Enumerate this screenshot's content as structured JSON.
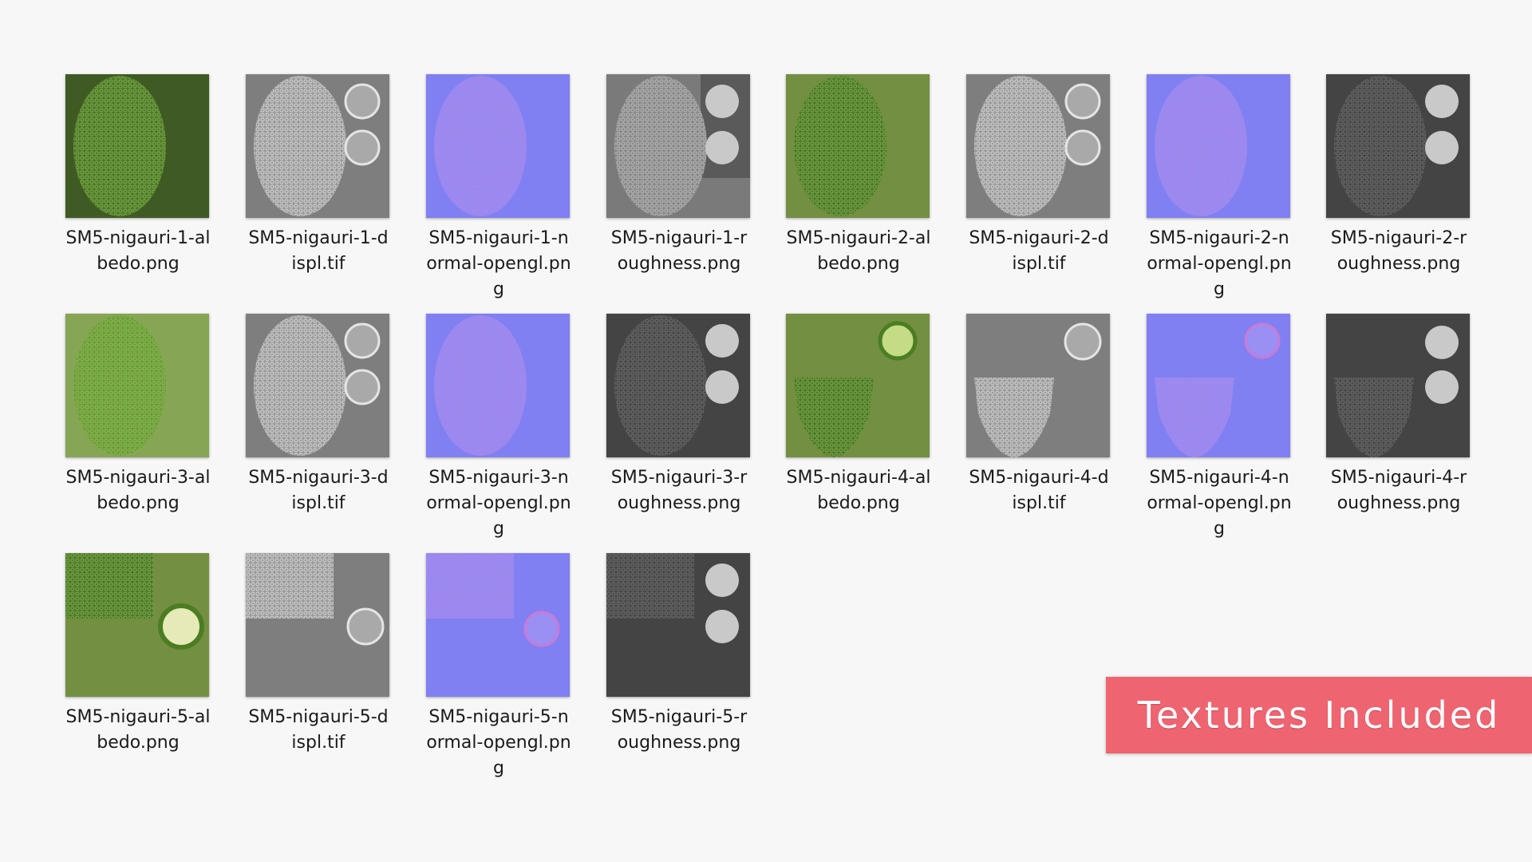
{
  "files": [
    {
      "line1": "SM5-nigauri-1-al",
      "line2": "bedo.png",
      "line3": "",
      "kind": "albedo",
      "variant": 1
    },
    {
      "line1": "SM5-nigauri-1-d",
      "line2": "ispl.tif",
      "line3": "",
      "kind": "displ",
      "variant": 1
    },
    {
      "line1": "SM5-nigauri-1-n",
      "line2": "ormal-opengl.pn",
      "line3": "g",
      "kind": "normal",
      "variant": 1
    },
    {
      "line1": "SM5-nigauri-1-r",
      "line2": "oughness.png",
      "line3": "",
      "kind": "roughness",
      "variant": 1
    },
    {
      "line1": "SM5-nigauri-2-al",
      "line2": "bedo.png",
      "line3": "",
      "kind": "albedo",
      "variant": 2
    },
    {
      "line1": "SM5-nigauri-2-d",
      "line2": "ispl.tif",
      "line3": "",
      "kind": "displ",
      "variant": 2
    },
    {
      "line1": "SM5-nigauri-2-n",
      "line2": "ormal-opengl.pn",
      "line3": "g",
      "kind": "normal",
      "variant": 2
    },
    {
      "line1": "SM5-nigauri-2-r",
      "line2": "oughness.png",
      "line3": "",
      "kind": "roughness",
      "variant": 2
    },
    {
      "line1": "SM5-nigauri-3-al",
      "line2": "bedo.png",
      "line3": "",
      "kind": "albedo",
      "variant": 3
    },
    {
      "line1": "SM5-nigauri-3-d",
      "line2": "ispl.tif",
      "line3": "",
      "kind": "displ",
      "variant": 3
    },
    {
      "line1": "SM5-nigauri-3-n",
      "line2": "ormal-opengl.pn",
      "line3": "g",
      "kind": "normal",
      "variant": 3
    },
    {
      "line1": "SM5-nigauri-3-r",
      "line2": "oughness.png",
      "line3": "",
      "kind": "roughness",
      "variant": 3
    },
    {
      "line1": "SM5-nigauri-4-al",
      "line2": "bedo.png",
      "line3": "",
      "kind": "albedo",
      "variant": 4
    },
    {
      "line1": "SM5-nigauri-4-d",
      "line2": "ispl.tif",
      "line3": "",
      "kind": "displ",
      "variant": 4
    },
    {
      "line1": "SM5-nigauri-4-n",
      "line2": "ormal-opengl.pn",
      "line3": "g",
      "kind": "normal",
      "variant": 4
    },
    {
      "line1": "SM5-nigauri-4-r",
      "line2": "oughness.png",
      "line3": "",
      "kind": "roughness",
      "variant": 4
    },
    {
      "line1": "SM5-nigauri-5-al",
      "line2": "bedo.png",
      "line3": "",
      "kind": "albedo",
      "variant": 5
    },
    {
      "line1": "SM5-nigauri-5-d",
      "line2": "ispl.tif",
      "line3": "",
      "kind": "displ",
      "variant": 5
    },
    {
      "line1": "SM5-nigauri-5-n",
      "line2": "ormal-opengl.pn",
      "line3": "g",
      "kind": "normal",
      "variant": 5
    },
    {
      "line1": "SM5-nigauri-5-r",
      "line2": "oughness.png",
      "line3": "",
      "kind": "roughness",
      "variant": 5
    }
  ],
  "badge": {
    "label": "Textures Included"
  },
  "colors": {
    "background": "#f7f7f7",
    "badge": "#ee6470",
    "albedo_bg": "#5e7d35",
    "albedo_dark": "#3f5a22",
    "displ_bg": "#7e7e7e",
    "normal_bg": "#8080f2",
    "roughness_bg": "#444444",
    "roughness_light_bg": "#7a7a7a"
  }
}
